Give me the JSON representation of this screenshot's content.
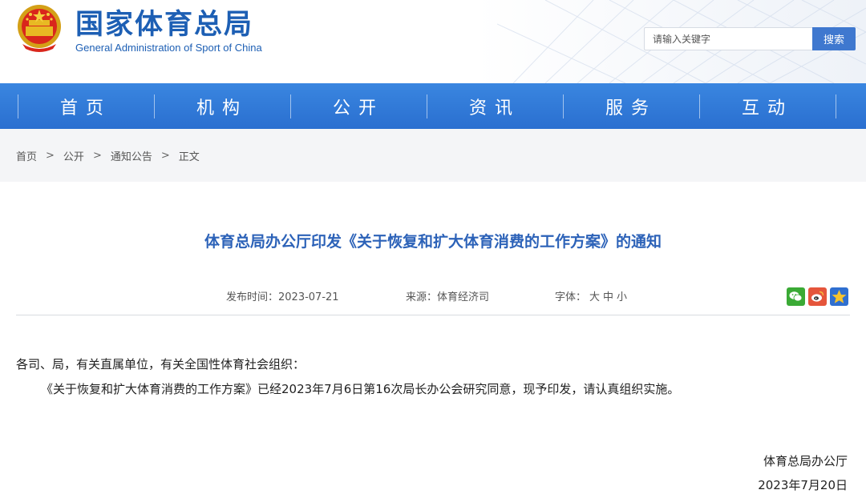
{
  "header": {
    "title_cn": "国家体育总局",
    "title_en": "General Administration of Sport of China",
    "search_placeholder": "请输入关键字",
    "search_button": "搜索"
  },
  "nav": {
    "items": [
      {
        "label": "首页"
      },
      {
        "label": "机构"
      },
      {
        "label": "公开"
      },
      {
        "label": "资讯"
      },
      {
        "label": "服务"
      },
      {
        "label": "互动"
      }
    ]
  },
  "breadcrumb": {
    "items": [
      "首页",
      "公开",
      "通知公告",
      "正文"
    ],
    "separator": ">"
  },
  "article": {
    "title": "体育总局办公厅印发《关于恢复和扩大体育消费的工作方案》的通知",
    "meta": {
      "date_label": "发布时间：",
      "date": "2023-07-21",
      "source_label": "来源：",
      "source": "体育经济司",
      "font_label": "字体：",
      "font_sizes": [
        "大",
        "中",
        "小"
      ]
    },
    "share_icons": [
      "wechat-icon",
      "weibo-icon",
      "qzone-icon"
    ],
    "paragraphs": [
      "各司、局，有关直属单位，有关全国性体育社会组织：",
      "《关于恢复和扩大体育消费的工作方案》已经2023年7月6日第16次局长办公会研究同意，现予印发，请认真组织实施。"
    ],
    "signature_org": "体育总局办公厅",
    "signature_date": "2023年7月20日"
  },
  "colors": {
    "brand_blue": "#1d5fb4",
    "nav_blue": "#2a6fd0",
    "title_blue": "#2c62b8",
    "search_button": "#3f78cf"
  }
}
